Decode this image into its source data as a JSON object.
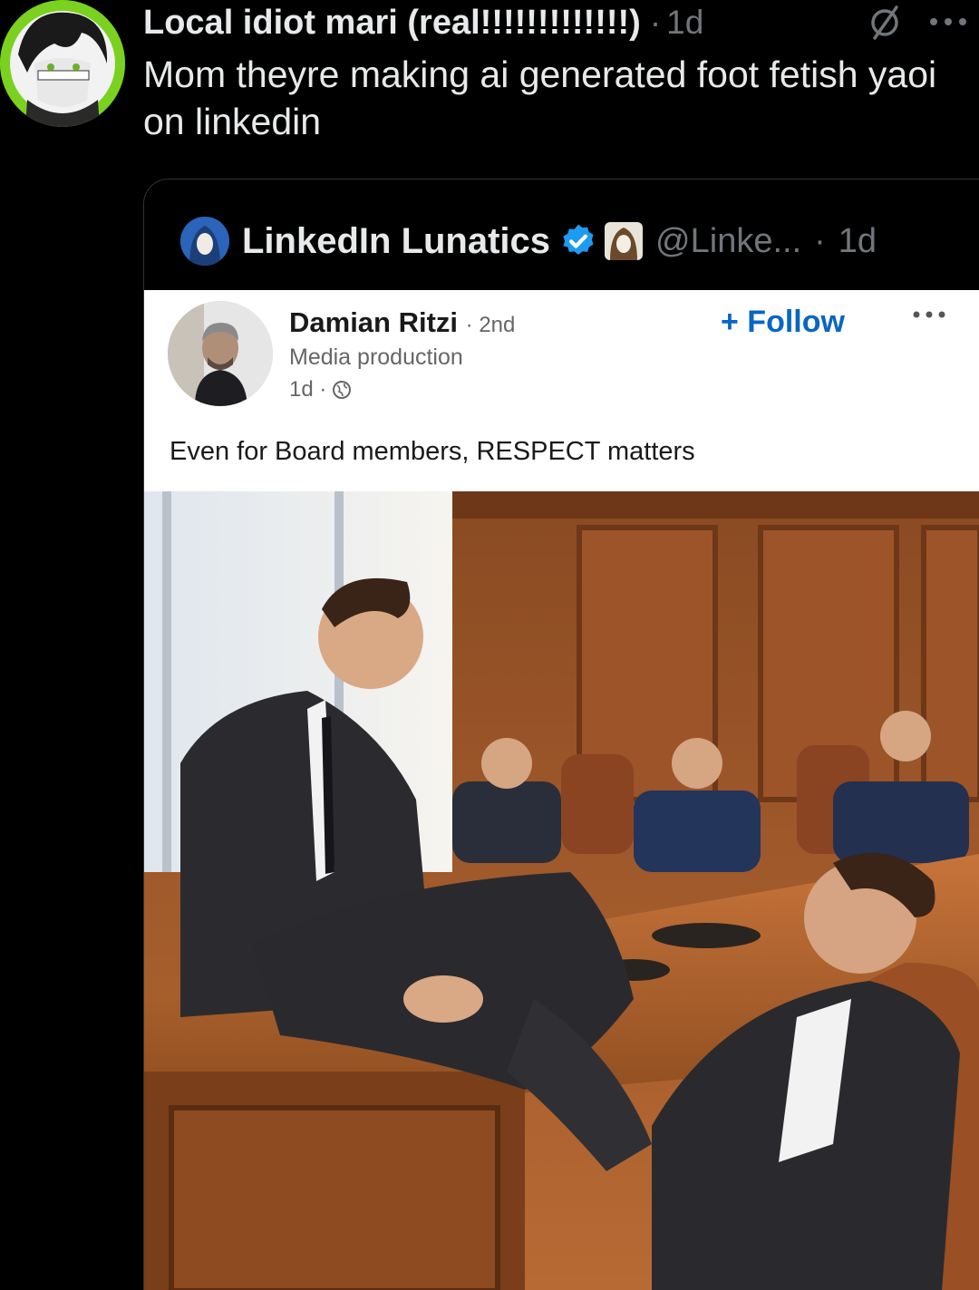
{
  "tweet": {
    "author_name": "Local idiot mari (real!!!!!!!!!!!!!)",
    "separator": "·",
    "time": "1d",
    "text": "Mom theyre making ai generated foot fetish yaoi on linkedin",
    "avatar_icon": "anime-avatar-icon",
    "grok_icon": "grok-icon",
    "more_icon": "more-icon"
  },
  "quote": {
    "name": "LinkedIn Lunatics",
    "handle": "@Linke...",
    "separator": "·",
    "time": "1d",
    "verified_color": "#1d9bf0"
  },
  "linkedin_post": {
    "author": "Damian Ritzi",
    "degree": "· 2nd",
    "headline": "Media production",
    "age": "1d ·",
    "follow_label": "+ Follow",
    "body": "Even for Board members, RESPECT matters",
    "follow_color": "#0a66c2"
  },
  "colors": {
    "background": "#000000",
    "primary_text": "#e7e9ea",
    "secondary_text": "#71767b",
    "border": "#2f3336"
  }
}
